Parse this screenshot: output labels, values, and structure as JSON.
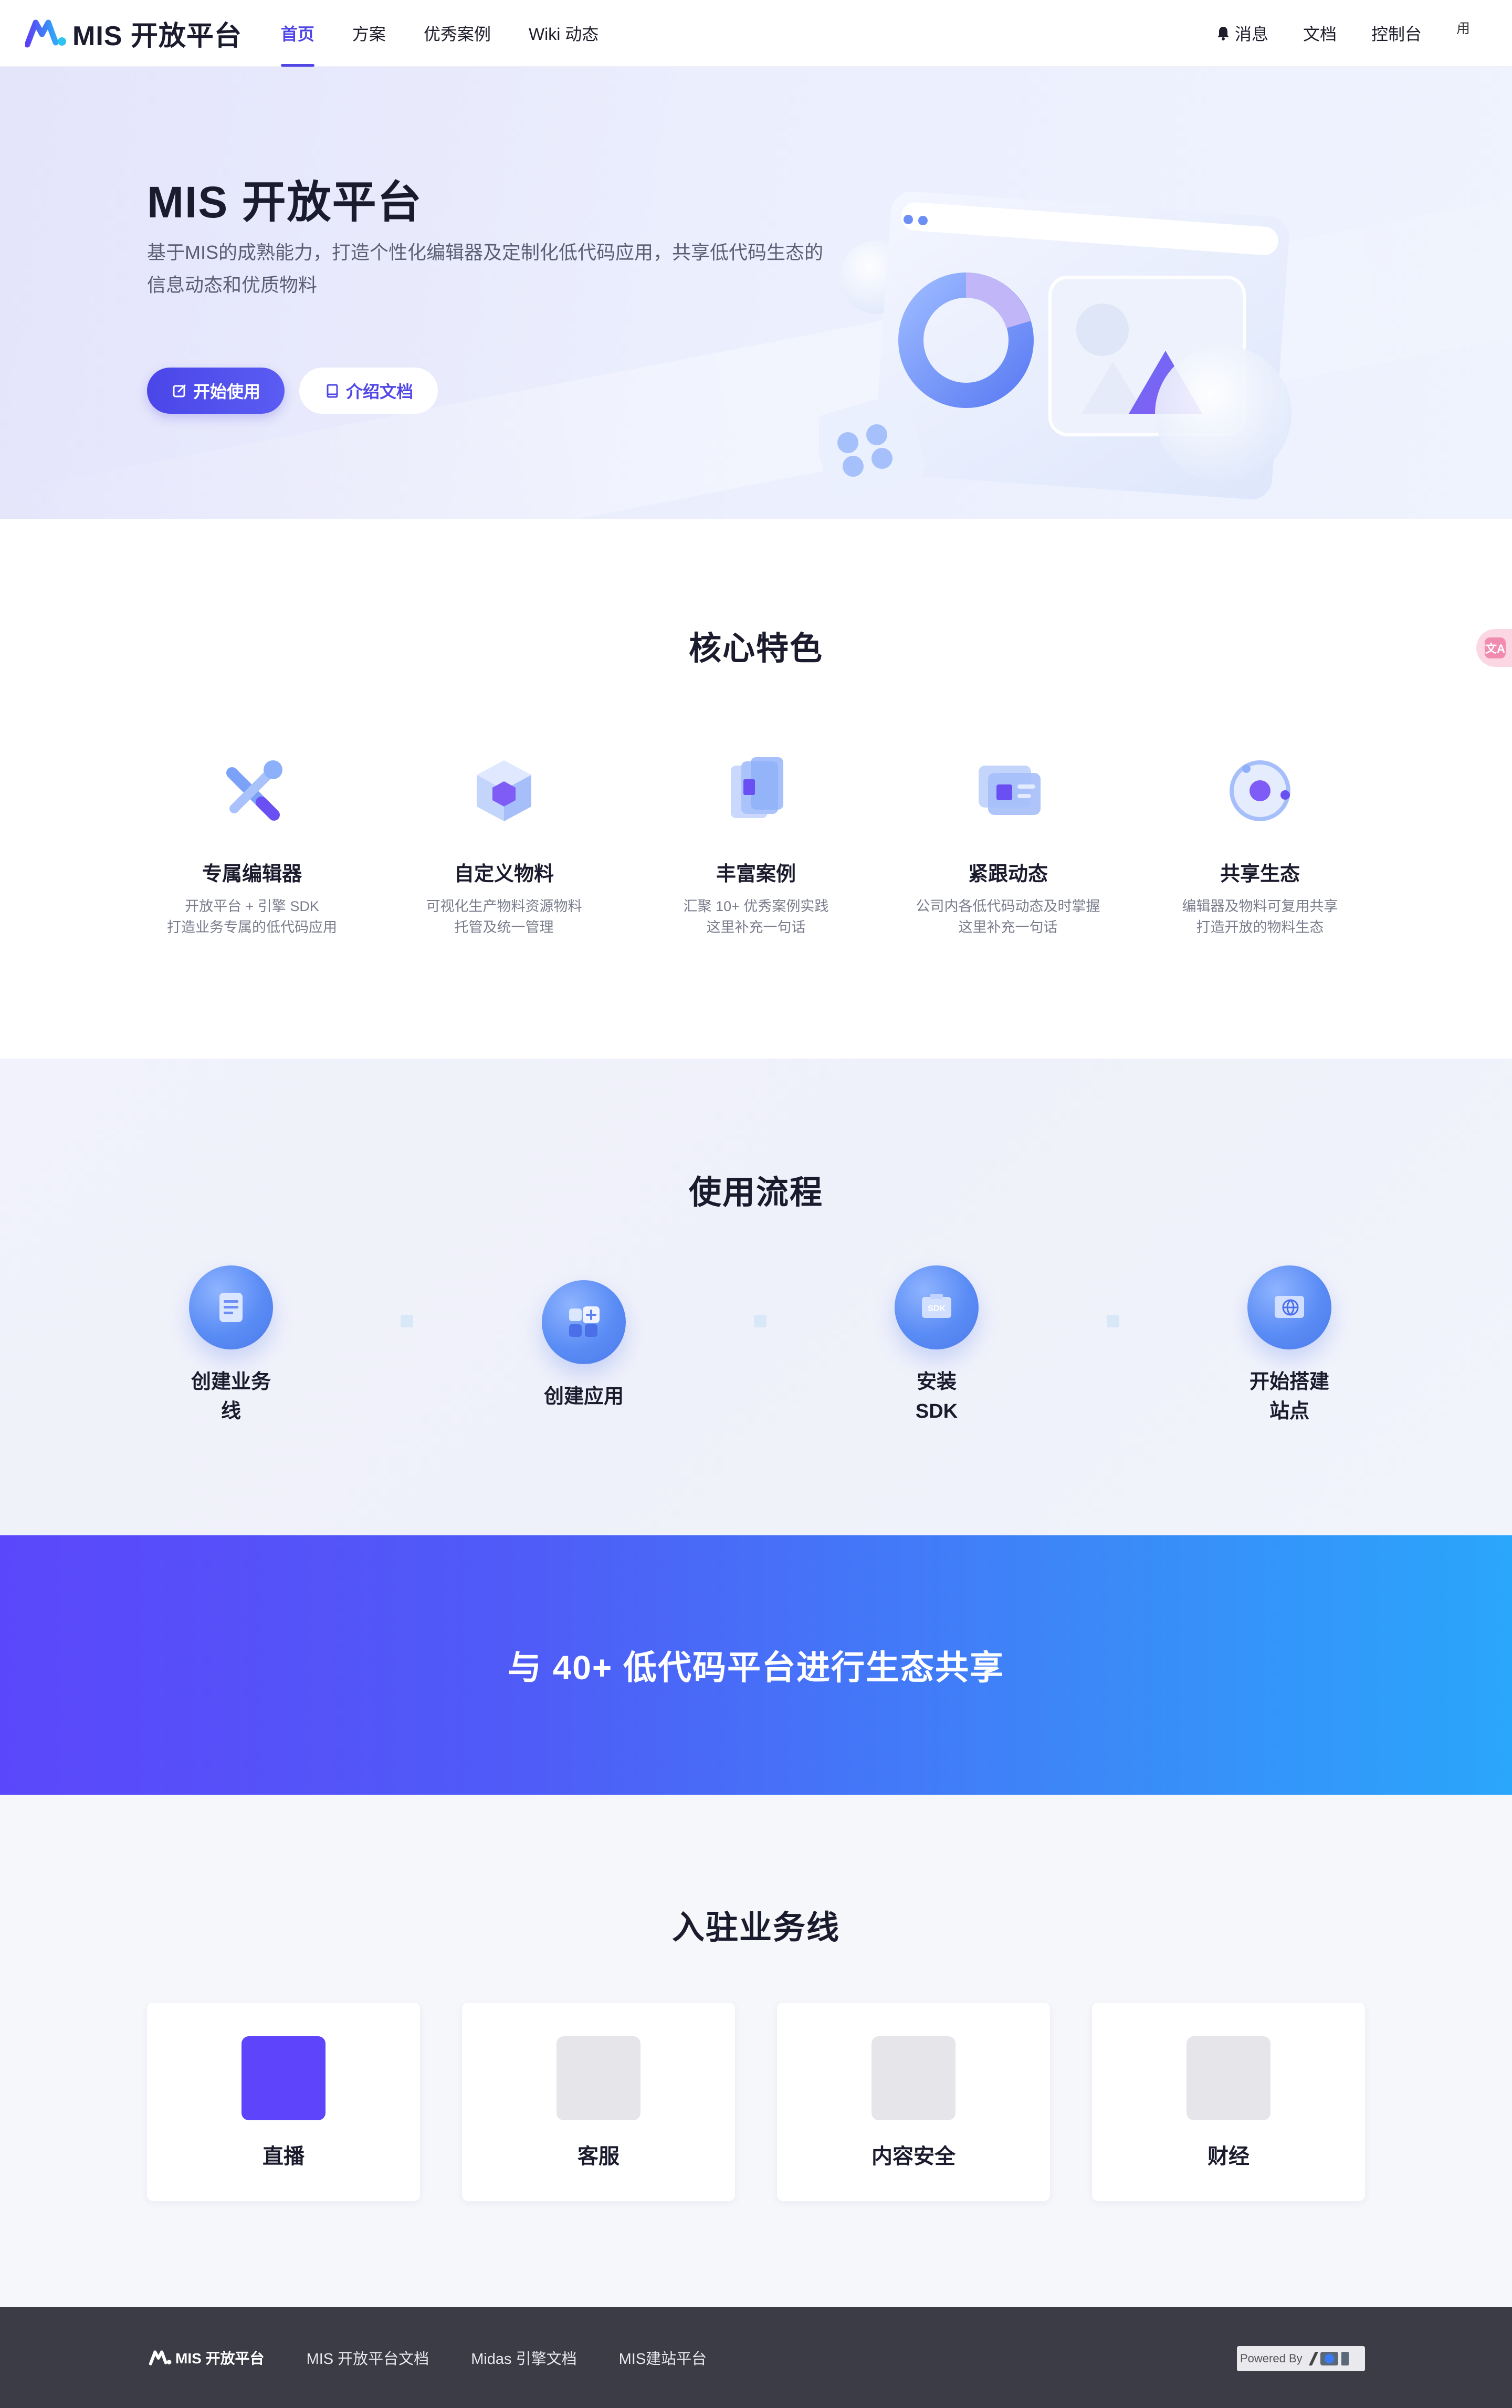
{
  "header": {
    "logo_text": "MIS 开放平台",
    "nav": [
      {
        "label": "首页",
        "active": true
      },
      {
        "label": "方案",
        "active": false
      },
      {
        "label": "优秀案例",
        "active": false
      },
      {
        "label": "Wiki 动态",
        "active": false
      }
    ],
    "right": {
      "messages": "消息",
      "docs": "文档",
      "console": "控制台",
      "avatar_alt": "用"
    }
  },
  "hero": {
    "title": "MIS 开放平台",
    "description": "基于MIS的成熟能力，打造个性化编辑器及定制化低代码应用，共享低代码生态的信息动态和优质物料",
    "primary_button": "开始使用",
    "secondary_button": "介绍文档"
  },
  "features": {
    "title": "核心特色",
    "items": [
      {
        "name": "专属编辑器",
        "desc_1": "开放平台 + 引擎 SDK",
        "desc_2": "打造业务专属的低代码应用",
        "icon": "tools-icon"
      },
      {
        "name": "自定义物料",
        "desc_1": "可视化生产物料资源物料",
        "desc_2": "托管及统一管理",
        "icon": "cube-icon"
      },
      {
        "name": "丰富案例",
        "desc_1": "汇聚 10+ 优秀案例实践",
        "desc_2": "这里补充一句话",
        "icon": "layers-icon"
      },
      {
        "name": "紧跟动态",
        "desc_1": "公司内各低代码动态及时掌握",
        "desc_2": "这里补充一句话",
        "icon": "news-icon"
      },
      {
        "name": "共享生态",
        "desc_1": "编辑器及物料可复用共享",
        "desc_2": "打造开放的物料生态",
        "icon": "orbit-icon"
      }
    ]
  },
  "flow": {
    "title": "使用流程",
    "steps": [
      {
        "label_1": "创建业务",
        "label_2": "线",
        "icon": "document-icon"
      },
      {
        "label_1": "创建应用",
        "label_2": "",
        "icon": "app-add-icon"
      },
      {
        "label_1": "安装",
        "label_2": "SDK",
        "icon": "sdk-icon"
      },
      {
        "label_1": "开始搭建",
        "label_2": "站点",
        "icon": "globe-icon"
      }
    ]
  },
  "banner": {
    "text": "与 40+ 低代码平台进行生态共享"
  },
  "business": {
    "title": "入驻业务线",
    "items": [
      {
        "name": "直播",
        "accent": true
      },
      {
        "name": "客服",
        "accent": false
      },
      {
        "name": "内容安全",
        "accent": false
      },
      {
        "name": "财经",
        "accent": false
      }
    ]
  },
  "footer": {
    "logo_text": "MIS 开放平台",
    "links": [
      "MIS 开放平台文档",
      "Midas 引擎文档",
      "MIS建站平台"
    ],
    "powered_by": "Powered By"
  },
  "side_float": {
    "label": "文A"
  },
  "colors": {
    "primary": "#4f46e5",
    "banner_start": "#5b47fb",
    "banner_end": "#2aa6fb",
    "footer_bg": "#3c3c46",
    "biz_accent": "#5e44fb"
  }
}
